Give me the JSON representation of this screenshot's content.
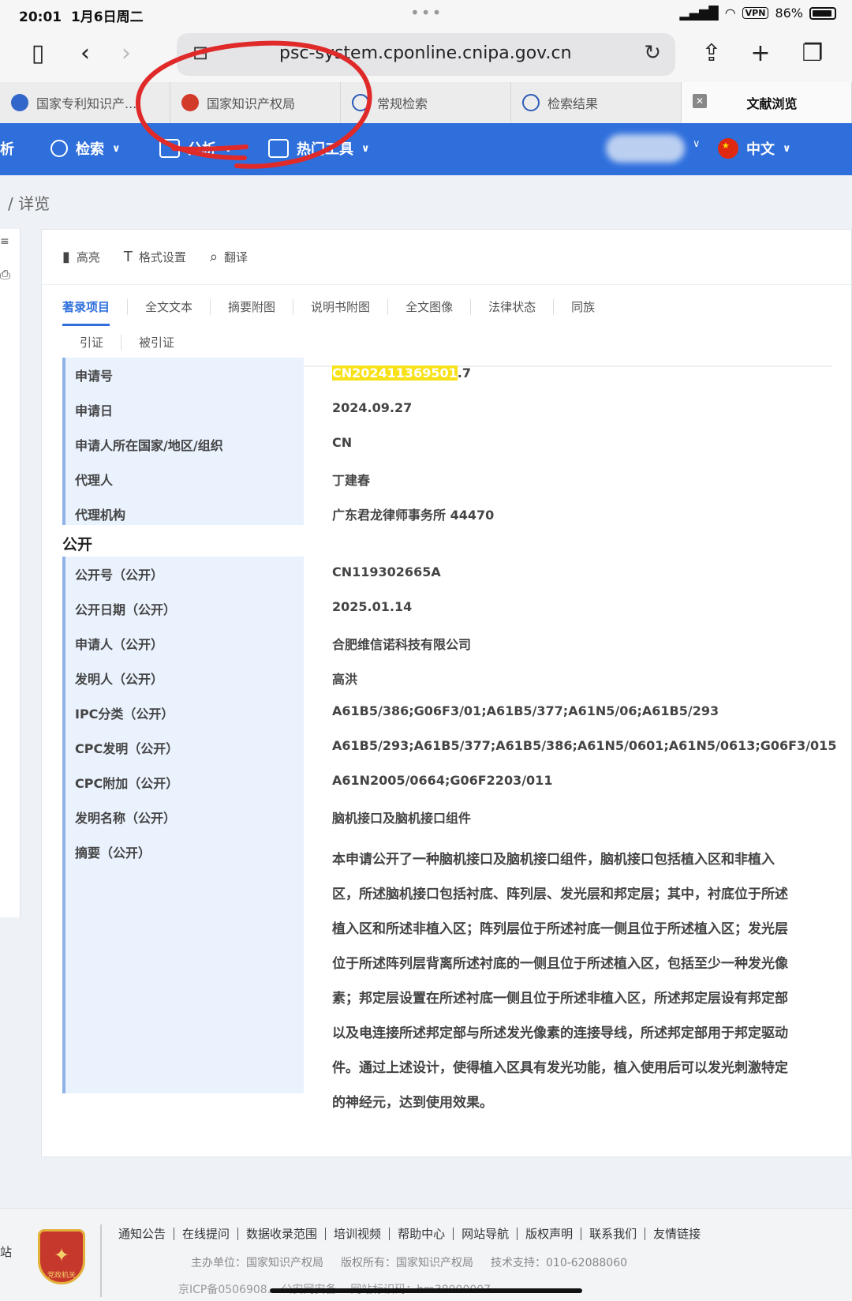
{
  "status_bar": {
    "time": "20:01",
    "date": "1月6日周二",
    "vpn": "VPN",
    "battery": "86%"
  },
  "browser": {
    "url": "psc-system.cponline.cnipa.gov.cn",
    "tabs": [
      {
        "label": "国家专利知识产...",
        "favicon_color": "#3266c9"
      },
      {
        "label": "国家知识产权局",
        "favicon_color": "#d23a2a"
      },
      {
        "label": "常规检索",
        "favicon_color": "#2d5bb8"
      },
      {
        "label": "检索结果",
        "favicon_color": "#2d5bb8"
      },
      {
        "label": "文献浏览",
        "favicon_color": "#888888",
        "active": true
      }
    ]
  },
  "nav": {
    "left_cut": "析",
    "items": [
      "检索",
      "分析",
      "热门工具"
    ],
    "language": "中文"
  },
  "breadcrumb": "/ 详览",
  "actions": [
    "高亮",
    "格式设置",
    "翻译"
  ],
  "subtabs_row1": [
    "著录项目",
    "全文文本",
    "摘要附图",
    "说明书附图",
    "全文图像",
    "法律状态",
    "同族"
  ],
  "subtabs_row2": [
    "引证",
    "被引证"
  ],
  "application": {
    "rows": [
      {
        "label": "申请号",
        "value_highlight": "CN202411369501",
        "value_rest": ".7"
      },
      {
        "label": "申请日",
        "value": "2024.09.27"
      },
      {
        "label": "申请人所在国家/地区/组织",
        "value": "CN"
      },
      {
        "label": "代理人",
        "value": "丁建春"
      },
      {
        "label": "代理机构",
        "value": "广东君龙律师事务所 44470"
      }
    ]
  },
  "publication": {
    "section_title": "公开",
    "rows": [
      {
        "label": "公开号（公开）",
        "value": "CN119302665A"
      },
      {
        "label": "公开日期（公开）",
        "value": "2025.01.14"
      },
      {
        "label": "申请人（公开）",
        "value": "合肥维信诺科技有限公司"
      },
      {
        "label": "发明人（公开）",
        "value": "高洪"
      },
      {
        "label": "IPC分类（公开）",
        "value": "A61B5/386;G06F3/01;A61B5/377;A61N5/06;A61B5/293"
      },
      {
        "label": "CPC发明（公开）",
        "value": "A61B5/293;A61B5/377;A61B5/386;A61N5/0601;A61N5/0613;G06F3/015"
      },
      {
        "label": "CPC附加（公开）",
        "value": "A61N2005/0664;G06F2203/011"
      },
      {
        "label": "发明名称（公开）",
        "value": "脑机接口及脑机接口组件"
      }
    ],
    "abstract_label": "摘要（公开）",
    "abstract": "本申请公开了一种脑机接口及脑机接口组件，脑机接口包括植入区和非植入区，所述脑机接口包括衬底、阵列层、发光层和邦定层；其中，衬底位于所述植入区和所述非植入区；阵列层位于所述衬底一侧且位于所述植入区；发光层位于所述阵列层背离所述衬底的一侧且位于所述植入区，包括至少一种发光像素；邦定层设置在所述衬底一侧且位于所述非植入区，所述邦定层设有邦定部以及电连接所述邦定部与所述发光像素的连接导线，所述邦定部用于邦定驱动件。通过上述设计，使得植入区具有发光功能，植入使用后可以发光刺激特定的神经元，达到使用效果。"
  },
  "footer": {
    "left_cut": "站",
    "emblem_text": "党政机关",
    "links": [
      "通知公告",
      "在线提问",
      "数据收录范围",
      "培训视频",
      "帮助中心",
      "网站导航",
      "版权声明",
      "联系我们",
      "友情链接"
    ],
    "host": "主办单位：国家知识产权局",
    "copyright": "版权所有：国家知识产权局",
    "support": "技术支持：010-62088060",
    "icp_cut": "京ICP备0506908... 公安网安备... 网站标识码：bm38000007"
  },
  "colors": {
    "nav_blue": "#2f6fdc",
    "label_bg": "#eaf2fd",
    "highlight": "#f7e21a",
    "annotation_red": "#e02a2a"
  }
}
